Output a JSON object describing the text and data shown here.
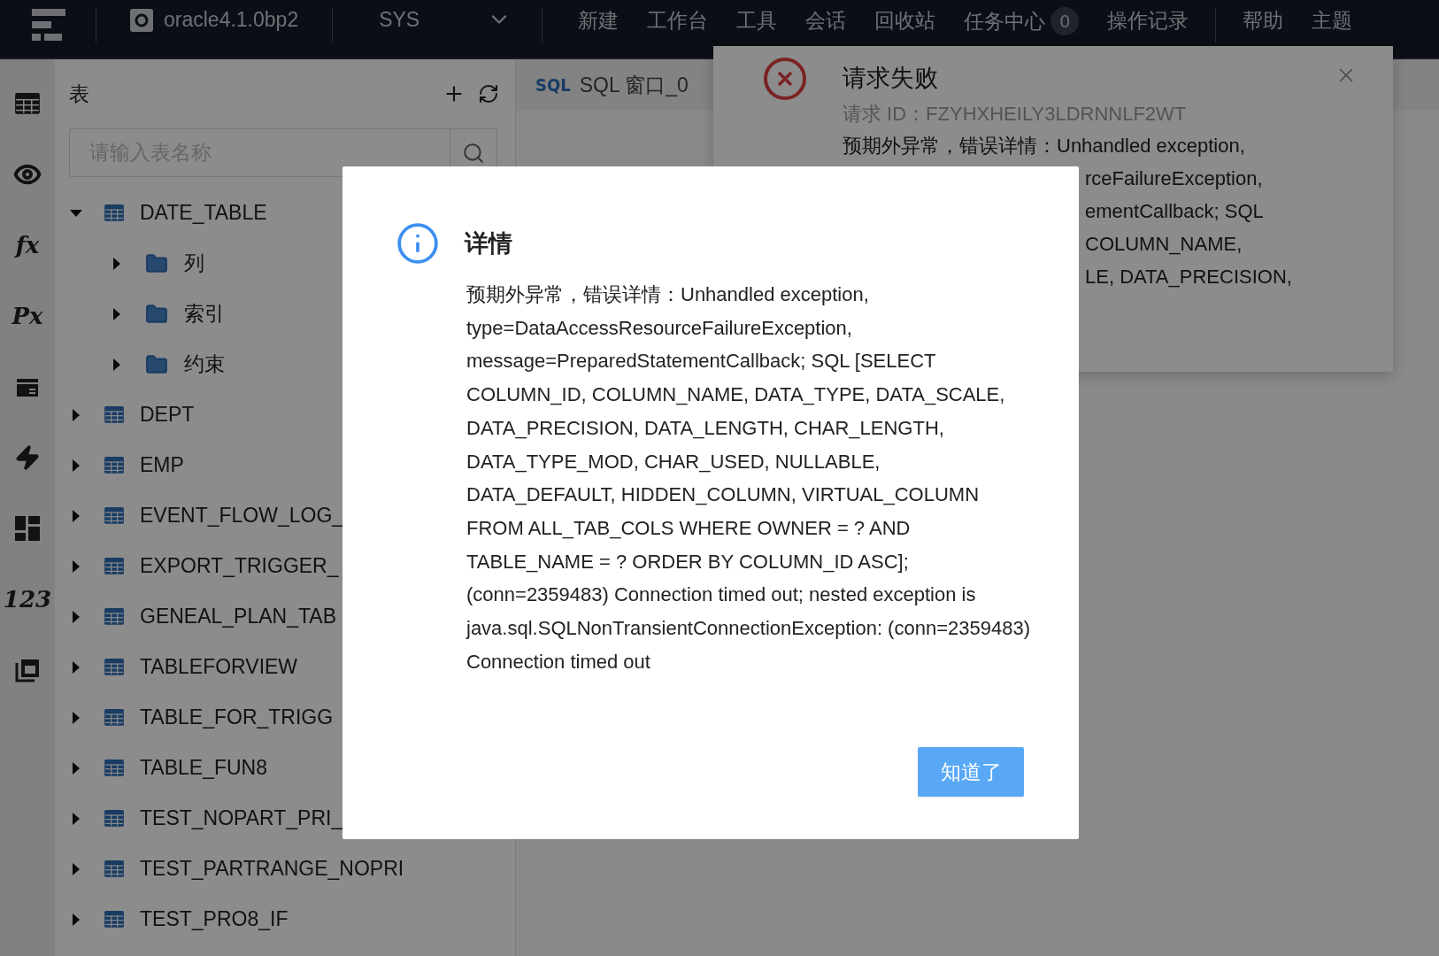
{
  "topbar": {
    "connection": "oracle4.1.0bp2",
    "user": "SYS",
    "nav": [
      {
        "label": "新建"
      },
      {
        "label": "工作台"
      },
      {
        "label": "工具"
      },
      {
        "label": "会话"
      },
      {
        "label": "回收站"
      },
      {
        "label": "任务中心",
        "badge": "0"
      },
      {
        "label": "操作记录"
      }
    ],
    "nav_right": [
      {
        "label": "帮助"
      },
      {
        "label": "主题"
      }
    ]
  },
  "rail": [
    {
      "kind": "grid"
    },
    {
      "kind": "eye"
    },
    {
      "kind": "glyph",
      "text": "fx"
    },
    {
      "kind": "glyph",
      "text": "Px"
    },
    {
      "kind": "box"
    },
    {
      "kind": "bolt"
    },
    {
      "kind": "dashboard"
    },
    {
      "kind": "glyph",
      "text": "123"
    },
    {
      "kind": "windows"
    }
  ],
  "panel": {
    "title": "表",
    "search": {
      "placeholder": "请输入表名称"
    },
    "tree": [
      {
        "label": "DATE_TABLE",
        "kind": "table",
        "expanded": true,
        "children": [
          {
            "label": "列",
            "kind": "folder",
            "expanded": false
          },
          {
            "label": "索引",
            "kind": "folder",
            "expanded": false
          },
          {
            "label": "约束",
            "kind": "folder",
            "expanded": false
          }
        ]
      },
      {
        "label": "DEPT",
        "kind": "table",
        "expanded": false
      },
      {
        "label": "EMP",
        "kind": "table",
        "expanded": false
      },
      {
        "label": "EVENT_FLOW_LOG_",
        "kind": "table",
        "expanded": false
      },
      {
        "label": "EXPORT_TRIGGER_",
        "kind": "table",
        "expanded": false
      },
      {
        "label": "GENEAL_PLAN_TAB",
        "kind": "table",
        "expanded": false
      },
      {
        "label": "TABLEFORVIEW",
        "kind": "table",
        "expanded": false
      },
      {
        "label": "TABLE_FOR_TRIGG",
        "kind": "table",
        "expanded": false
      },
      {
        "label": "TABLE_FUN8",
        "kind": "table",
        "expanded": false
      },
      {
        "label": "TEST_NOPART_PRI_",
        "kind": "table",
        "expanded": false
      },
      {
        "label": "TEST_PARTRANGE_NOPRI",
        "kind": "table",
        "expanded": false
      },
      {
        "label": "TEST_PRO8_IF",
        "kind": "table",
        "expanded": false
      }
    ]
  },
  "tabs": [
    {
      "label": "SQL 窗口_0",
      "icon_text": "SQL"
    }
  ],
  "notification": {
    "title": "请求失败",
    "request_id": "请求 ID：FZYHXHEILY3LDRNNLF2WT",
    "first_line": "预期外异常，错误详情：Unhandled exception,",
    "covered_lines": [
      "rceFailureException,",
      "ementCallback; SQL",
      "COLUMN_NAME,",
      "LE, DATA_PRECISION,"
    ]
  },
  "modal": {
    "title": "详情",
    "message": "预期外异常，错误详情：Unhandled exception, type=DataAccessResourceFailureException, message=PreparedStatementCallback; SQL [SELECT COLUMN_ID, COLUMN_NAME, DATA_TYPE, DATA_SCALE, DATA_PRECISION, DATA_LENGTH, CHAR_LENGTH, DATA_TYPE_MOD, CHAR_USED, NULLABLE, DATA_DEFAULT, HIDDEN_COLUMN, VIRTUAL_COLUMN FROM ALL_TAB_COLS WHERE OWNER = ? AND TABLE_NAME = ? ORDER BY COLUMN_ID ASC]; (conn=2359483) Connection timed out; nested exception is java.sql.SQLNonTransientConnectionException: (conn=2359483) Connection timed out",
    "button": "知道了"
  }
}
